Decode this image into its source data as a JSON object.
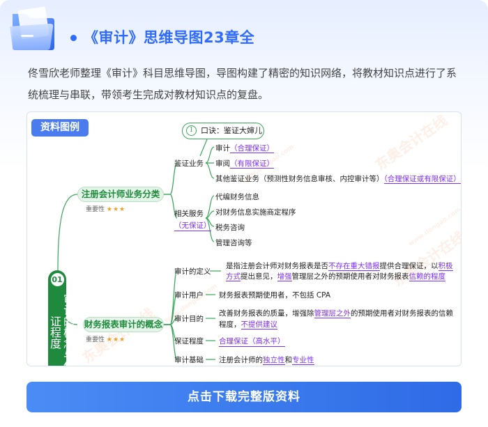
{
  "header": {
    "title": "《审计》思维导图23章全",
    "description": "佟雪欣老师整理《审计》科目思维导图，导图构建了精密的知识网络，将教材知识点进行了系统梳理与串联，带领考生完成对教材知识点的复盘。"
  },
  "mindmap": {
    "badge": "资料图例",
    "watermark_text": "东奥会计在线",
    "watermark_url": "www.dongao.com",
    "tip": {
      "num": "1",
      "text": "口诀：鉴证大婶儿"
    },
    "root": {
      "num": "01",
      "text": "审计的概念与保证程度"
    },
    "importance_label": "重要性",
    "importance_stars": "★★★",
    "branch1": {
      "title": "注册会计师业务分类",
      "groups": {
        "assurance": {
          "label": "鉴证业务",
          "items": [
            {
              "text": "审计",
              "kw": "（合理保证）"
            },
            {
              "text": "审阅",
              "kw": "（有限保证）"
            },
            {
              "text": "其他鉴证业务（预测性财务信息审核、内控审计等）",
              "kw": "（合理保证或有限保证）"
            }
          ]
        },
        "related": {
          "label": "相关服务",
          "kw": "（无保证）",
          "items": [
            "代编财务信息",
            "对财务信息实施商定程序",
            "税务咨询",
            "管理咨询等"
          ]
        }
      }
    },
    "branch2": {
      "title": "财务报表审计的概念",
      "rows": {
        "definition": {
          "label": "审计的定义",
          "l1a": "是指注册会计师对财务报表是否",
          "l1b": "不存在重大错报",
          "l1c": "提供合理保证，以",
          "l1d": "积极",
          "l2a": "方式",
          "l2b": "提出意见，",
          "l2c": "增强",
          "l2d": "管理层之外的预期使用者对财务报表",
          "l2e": "信赖的程度"
        },
        "users": {
          "label": "审计用户",
          "text": "财务报表预期使用者，不包括 CPA"
        },
        "purpose": {
          "label": "审计目的",
          "l1a": "改善财务报表的质量，增强除",
          "l1b": "管理层之外",
          "l1c": "的预期使用者对财务报表的信赖",
          "l2a": "程度，",
          "l2b": "不提供建议"
        },
        "assurance_level": {
          "label": "保证程度",
          "kw": "合理保证（高水平）"
        },
        "basis": {
          "label": "审计基础",
          "a": "注册会计师的",
          "b": "独立性",
          "c": "和",
          "d": "专业性"
        }
      }
    }
  },
  "cta": {
    "label": "点击下载完整版资料"
  }
}
